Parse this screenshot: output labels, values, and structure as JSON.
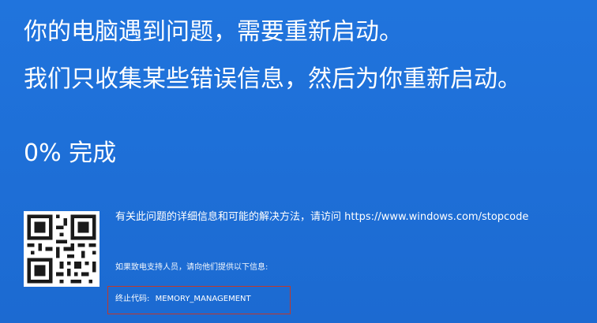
{
  "bsod": {
    "line1": "你的电脑遇到问题，需要重新启动。",
    "line2": "我们只收集某些错误信息，然后为你重新启动。",
    "progress": {
      "percent": 0,
      "text": "0% 完成"
    },
    "more_info": {
      "text": "有关此问题的详细信息和可能的解决方法，请访问",
      "url": "https://www.windows.com/stopcode"
    },
    "support_note": "如果致电支持人员，请向他们提供以下信息:",
    "stop_code": {
      "label": "终止代码:",
      "value": "MEMORY_MANAGEMENT"
    }
  },
  "colors": {
    "background": "#1f6fd6",
    "text": "#ffffff",
    "highlight_box": "#c0392b"
  },
  "icons": {
    "qr": "qr-code-icon"
  }
}
